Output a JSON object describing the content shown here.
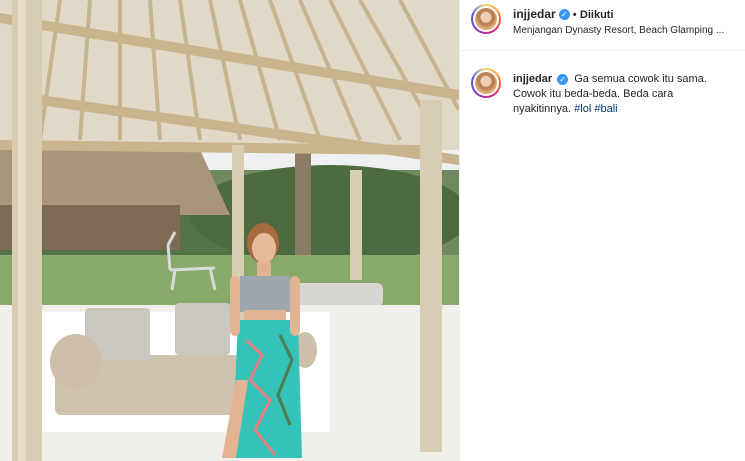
{
  "post": {
    "username": "injjedar",
    "follow_label": "Diikuti",
    "separator": "•",
    "location": "Menjangan Dynasty Resort, Beach Glamping ...",
    "caption": {
      "username": "injjedar",
      "text": "Ga semua cowok itu sama. Cowok itu beda-beda. Beda cara nyakitinnya.",
      "hashtags": [
        "#lol",
        "#bali"
      ]
    }
  },
  "icons": {
    "verified": "verified-badge-icon",
    "avatar": "profile-avatar"
  },
  "colors": {
    "accent": "#3897f0",
    "hashtag": "#00376b",
    "text": "#262626",
    "border": "#efefef"
  }
}
